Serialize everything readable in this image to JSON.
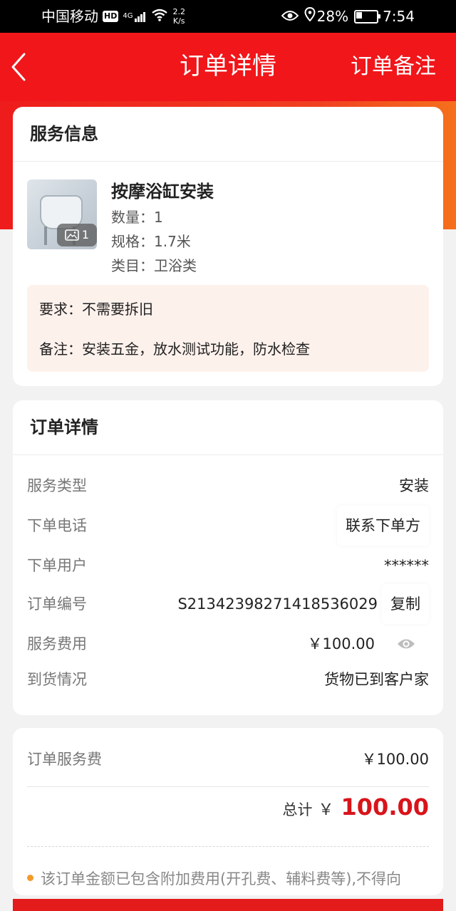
{
  "status_bar": {
    "carrier": "中国移动",
    "hd": "HD",
    "net": "4G",
    "speed_value": "2.2",
    "speed_unit": "K/s",
    "battery": "28%",
    "time": "7:54"
  },
  "header": {
    "title": "订单详情",
    "remark_button": "订单备注"
  },
  "service_info": {
    "section_title": "服务信息",
    "image_count": "1",
    "name": "按摩浴缸安装",
    "quantity": "数量：1",
    "spec": "规格：1.7米",
    "category": "类目：卫浴类",
    "requirement": "要求：不需要拆旧",
    "note": "备注：安装五金，放水测试功能，防水检查"
  },
  "order_detail": {
    "section_title": "订单详情",
    "rows": [
      {
        "label": "服务类型",
        "value": "安装"
      },
      {
        "label": "下单电话",
        "value": "联系下单方"
      },
      {
        "label": "下单用户",
        "value": "******"
      },
      {
        "label": "订单编号",
        "value": "S2134239827141853​6029",
        "action": "复制"
      },
      {
        "label": "服务费用",
        "value": "￥100.00"
      },
      {
        "label": "到货情况",
        "value": "货物已到客户家"
      }
    ]
  },
  "fee": {
    "label": "订单服务费",
    "value": "￥100.00",
    "total_label": "总计",
    "total_currency": "￥",
    "total_amount": "100.00",
    "notice": "该订单金额已包含附加费用(开孔费、辅料费等),不得向"
  },
  "colors": {
    "brand_red": "#f0161a",
    "price_red": "#d8141b",
    "notice_dot": "#f39a2b"
  }
}
